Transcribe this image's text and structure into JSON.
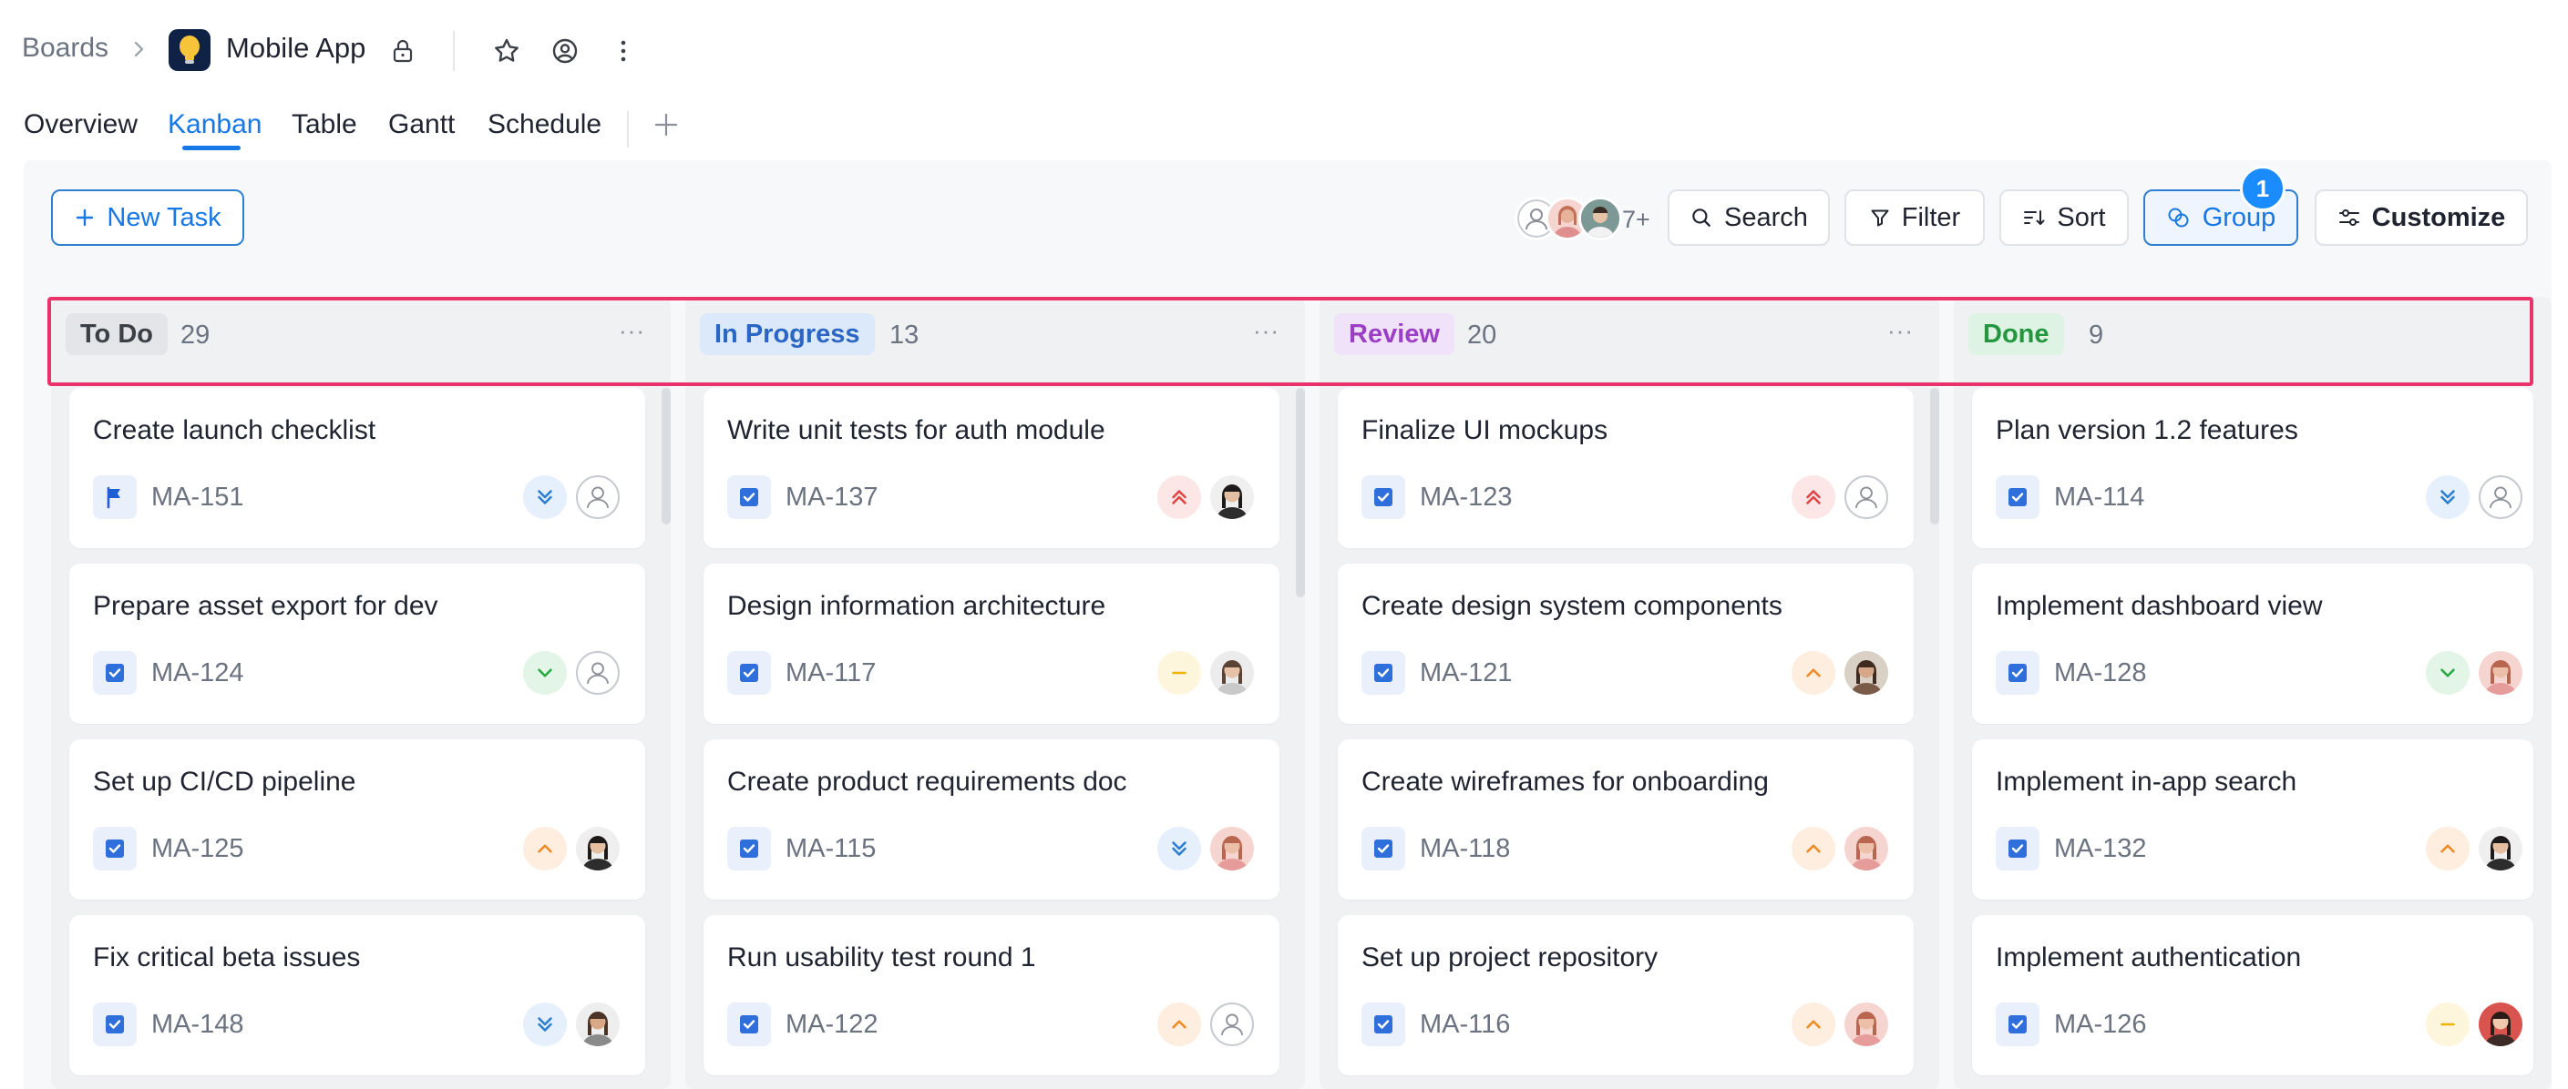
{
  "header": {
    "breadcrumb": "Boards",
    "app_title": "Mobile App"
  },
  "tabs": [
    {
      "label": "Overview"
    },
    {
      "label": "Kanban"
    },
    {
      "label": "Table"
    },
    {
      "label": "Gantt"
    },
    {
      "label": "Schedule"
    }
  ],
  "active_tab": "Kanban",
  "toolbar": {
    "new_task": "New Task",
    "members_more": "7+",
    "search": "Search",
    "filter": "Filter",
    "sort": "Sort",
    "group": "Group",
    "group_badge": "1",
    "customize": "Customize"
  },
  "colors": {
    "accent": "#1677e6",
    "highlight": "#e8346a",
    "todo_pill_bg": "#e4e5e8",
    "todo_pill_fg": "#3b3f46",
    "progress_pill_bg": "#dce9fb",
    "progress_pill_fg": "#2a66c4",
    "review_pill_bg": "#f0e2f8",
    "review_pill_fg": "#9b3fc6",
    "done_pill_bg": "#dff3e4",
    "done_pill_fg": "#23963f",
    "prio_lowest": "#2f7fd1",
    "prio_low": "#27a843",
    "prio_medium": "#f0b400",
    "prio_high": "#f08a24",
    "prio_highest": "#e04646"
  },
  "columns": [
    {
      "label": "To Do",
      "count": "29",
      "cards": [
        {
          "title": "Create launch checklist",
          "key": "MA-151",
          "type": "flag-icon",
          "priority": "lowest",
          "assignee": "unassigned"
        },
        {
          "title": "Prepare asset export for dev",
          "key": "MA-124",
          "type": "checkbox-icon",
          "priority": "low",
          "assignee": "unassigned"
        },
        {
          "title": "Set up CI/CD pipeline",
          "key": "MA-125",
          "type": "checkbox-icon",
          "priority": "high",
          "assignee": "woman-dark-hair"
        },
        {
          "title": "Fix critical beta issues",
          "key": "MA-148",
          "type": "checkbox-icon",
          "priority": "lowest",
          "assignee": "man-beard"
        }
      ]
    },
    {
      "label": "In Progress",
      "count": "13",
      "cards": [
        {
          "title": "Write unit tests for auth module",
          "key": "MA-137",
          "type": "checkbox-icon",
          "priority": "highest",
          "assignee": "woman-dark-hair"
        },
        {
          "title": "Design information architecture",
          "key": "MA-117",
          "type": "checkbox-icon",
          "priority": "medium",
          "assignee": "man-light"
        },
        {
          "title": "Create product requirements doc",
          "key": "MA-115",
          "type": "checkbox-icon",
          "priority": "lowest",
          "assignee": "woman-pink"
        },
        {
          "title": "Run usability test round 1",
          "key": "MA-122",
          "type": "checkbox-icon",
          "priority": "high",
          "assignee": "unassigned"
        }
      ]
    },
    {
      "label": "Review",
      "count": "20",
      "cards": [
        {
          "title": "Finalize UI mockups",
          "key": "MA-123",
          "type": "checkbox-icon",
          "priority": "highest",
          "assignee": "unassigned"
        },
        {
          "title": "Create design system components",
          "key": "MA-121",
          "type": "checkbox-icon",
          "priority": "high",
          "assignee": "woman-brown"
        },
        {
          "title": "Create wireframes for onboarding",
          "key": "MA-118",
          "type": "checkbox-icon",
          "priority": "high",
          "assignee": "woman-pink"
        },
        {
          "title": "Set up project repository",
          "key": "MA-116",
          "type": "checkbox-icon",
          "priority": "high",
          "assignee": "woman-pink"
        }
      ]
    },
    {
      "label": "Done",
      "count": "9",
      "cards": [
        {
          "title": "Plan version 1.2 features",
          "key": "MA-114",
          "type": "checkbox-icon",
          "priority": "lowest",
          "assignee": "unassigned"
        },
        {
          "title": "Implement dashboard view",
          "key": "MA-128",
          "type": "checkbox-icon",
          "priority": "low",
          "assignee": "woman-pink"
        },
        {
          "title": "Implement in-app search",
          "key": "MA-132",
          "type": "checkbox-icon",
          "priority": "high",
          "assignee": "woman-dark-hair"
        },
        {
          "title": "Implement authentication",
          "key": "MA-126",
          "type": "checkbox-icon",
          "priority": "medium",
          "assignee": "woman-red"
        }
      ]
    }
  ]
}
